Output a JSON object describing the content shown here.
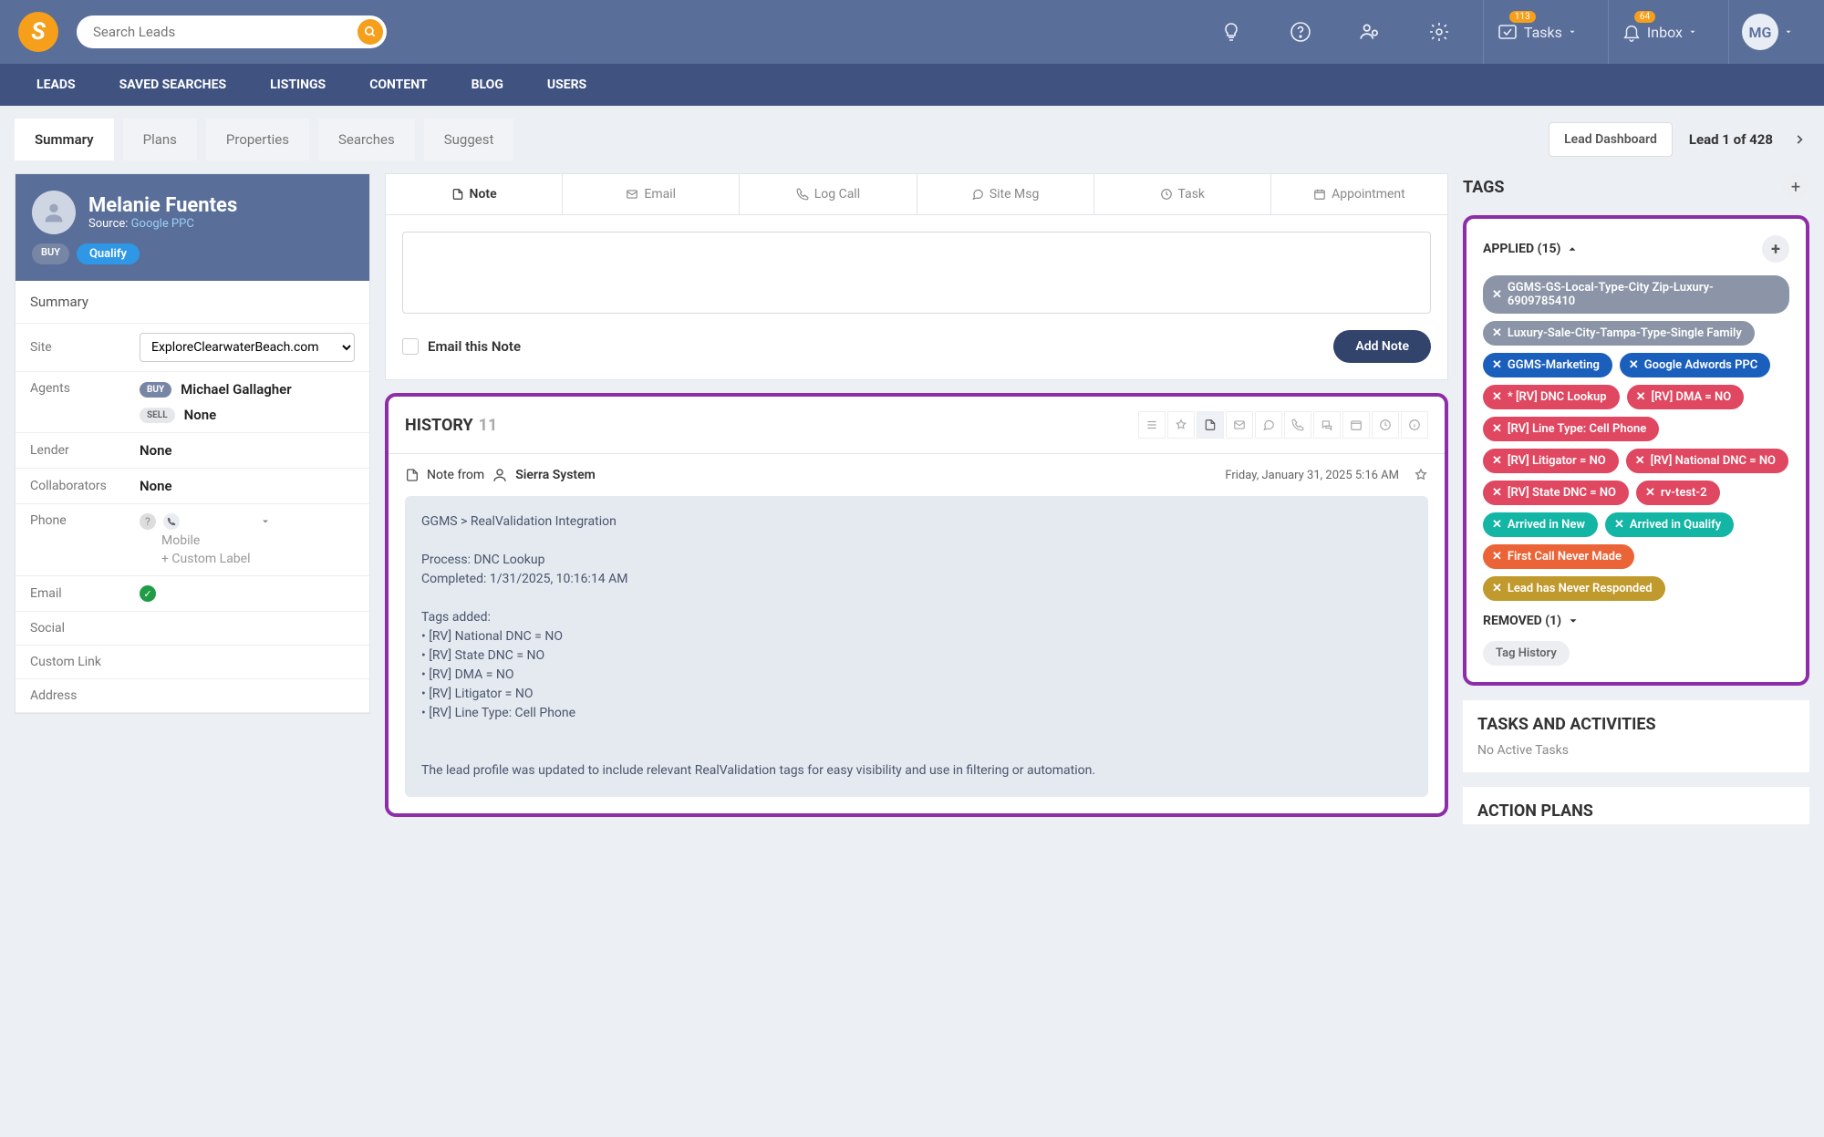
{
  "topbar": {
    "search_placeholder": "Search Leads",
    "tasks_label": "Tasks",
    "tasks_badge": "113",
    "inbox_label": "Inbox",
    "inbox_badge": "64",
    "avatar_initials": "MG"
  },
  "nav": {
    "leads": "LEADS",
    "saved": "SAVED SEARCHES",
    "listings": "LISTINGS",
    "content": "CONTENT",
    "blog": "BLOG",
    "users": "USERS"
  },
  "tabs": {
    "summary": "Summary",
    "plans": "Plans",
    "properties": "Properties",
    "searches": "Searches",
    "suggest": "Suggest",
    "dashboard_btn": "Lead Dashboard",
    "pager": "Lead 1 of 428"
  },
  "lead": {
    "name": "Melanie Fuentes",
    "source_label": "Source:",
    "source_link": "Google PPC",
    "buy_pill": "BUY",
    "qualify_pill": "Qualify",
    "summary_label": "Summary",
    "site_label": "Site",
    "site_value": "ExploreClearwaterBeach.com",
    "agents_label": "Agents",
    "buy_badge": "BUY",
    "buy_agent": "Michael Gallagher",
    "sell_badge": "SELL",
    "sell_agent": "None",
    "lender_label": "Lender",
    "lender_value": "None",
    "collab_label": "Collaborators",
    "collab_value": "None",
    "phone_label": "Phone",
    "phone_mobile": "Mobile",
    "phone_custom": "+ Custom Label",
    "email_label": "Email",
    "social_label": "Social",
    "custom_link_label": "Custom Link",
    "address_label": "Address"
  },
  "composer": {
    "tabs": {
      "note": "Note",
      "email": "Email",
      "log_call": "Log Call",
      "site_msg": "Site Msg",
      "task": "Task",
      "appointment": "Appointment"
    },
    "email_note_label": "Email this Note",
    "add_note_btn": "Add Note"
  },
  "history": {
    "title": "HISTORY",
    "count": "11",
    "note_from_label": "Note from",
    "note_author": "Sierra System",
    "note_time": "Friday, January 31, 2025 5:16 AM",
    "note_body": "GGMS > RealValidation Integration\n\nProcess: DNC Lookup\nCompleted: 1/31/2025, 10:16:14 AM\n\nTags added:\n• [RV] National DNC = NO\n• [RV] State DNC = NO\n• [RV] DMA = NO\n• [RV] Litigator = NO\n• [RV] Line Type: Cell Phone\n\n\nThe lead profile was updated to include relevant RealValidation tags for easy visibility and use in filtering or automation."
  },
  "tags": {
    "title": "TAGS",
    "applied_label": "APPLIED (15)",
    "removed_label": "REMOVED (1)",
    "history_label": "Tag History",
    "items": [
      {
        "text": "GGMS-GS-Local-Type-City Zip-Luxury-6909785410",
        "color": "gray"
      },
      {
        "text": "Luxury-Sale-City-Tampa-Type-Single Family",
        "color": "gray"
      },
      {
        "text": "GGMS-Marketing",
        "color": "blue"
      },
      {
        "text": "Google Adwords PPC",
        "color": "blue"
      },
      {
        "text": "* [RV] DNC Lookup",
        "color": "red"
      },
      {
        "text": "[RV] DMA = NO",
        "color": "red"
      },
      {
        "text": "[RV] Line Type: Cell Phone",
        "color": "red"
      },
      {
        "text": "[RV] Litigator = NO",
        "color": "red"
      },
      {
        "text": "[RV] National DNC = NO",
        "color": "red"
      },
      {
        "text": "[RV] State DNC = NO",
        "color": "red"
      },
      {
        "text": "rv-test-2",
        "color": "red"
      },
      {
        "text": "Arrived in New",
        "color": "teal"
      },
      {
        "text": "Arrived in Qualify",
        "color": "teal"
      },
      {
        "text": "First Call Never Made",
        "color": "orange"
      },
      {
        "text": "Lead has Never Responded",
        "color": "olive"
      }
    ]
  },
  "tasks_sec": {
    "title": "TASKS AND ACTIVITIES",
    "empty": "No Active Tasks"
  },
  "action_plans": {
    "title": "ACTION PLANS"
  }
}
